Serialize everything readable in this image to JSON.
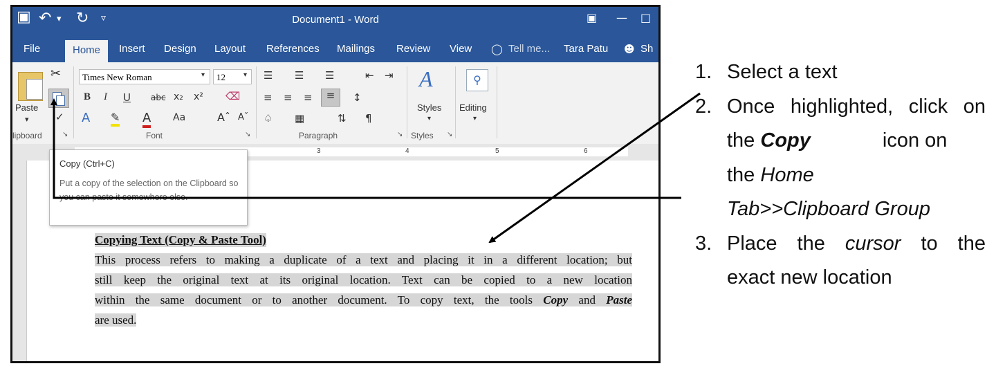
{
  "window": {
    "title": "Document1 - Word",
    "tabs": [
      "File",
      "Home",
      "Insert",
      "Design",
      "Layout",
      "References",
      "Mailings",
      "Review",
      "View"
    ],
    "tell_me": "Tell me...",
    "user": "Tara Patu",
    "share": "Sh"
  },
  "ribbon": {
    "paste_label": "Paste",
    "font_name": "Times New Roman",
    "font_size": "12",
    "styles_label": "Styles",
    "editing_label": "Editing",
    "groups": {
      "clipboard": "lipboard",
      "font": "Font",
      "paragraph": "Paragraph",
      "styles": "Styles"
    },
    "ruler_numbers": [
      "3",
      "4",
      "5",
      "6"
    ]
  },
  "tooltip": {
    "title": "Copy (Ctrl+C)",
    "body": "Put a copy of the selection on the Clipboard so you can paste it somewhere else."
  },
  "document": {
    "heading": "Copying Text (Copy & Paste Tool)",
    "lines": [
      "This process refers to making a duplicate of a text and placing it in a different location; but",
      "still keep the original text at its original location. Text can be copied to a new location",
      "within the same document or to another document. To copy text, the tools ",
      "are used."
    ],
    "copy_word": "Copy",
    "and_word": " and ",
    "paste_word": "Paste"
  },
  "instructions": {
    "step1_num": "1.",
    "step1": "Select a text",
    "step2_num": "2.",
    "step2_a": "Once highlighted, click on",
    "step2_the": "the ",
    "step2_copy": "Copy",
    "step2_b": "icon on",
    "step2_c": "the ",
    "step2_home": "Home",
    "step2_d": "Tab>>Clipboard Group",
    "step3_num": "3.",
    "step3_a1": "Place",
    "step3_a2": "the",
    "step3_a3": "cursor",
    "step3_a4": "to",
    "step3_a5": "the",
    "step3_b": "exact new location"
  }
}
